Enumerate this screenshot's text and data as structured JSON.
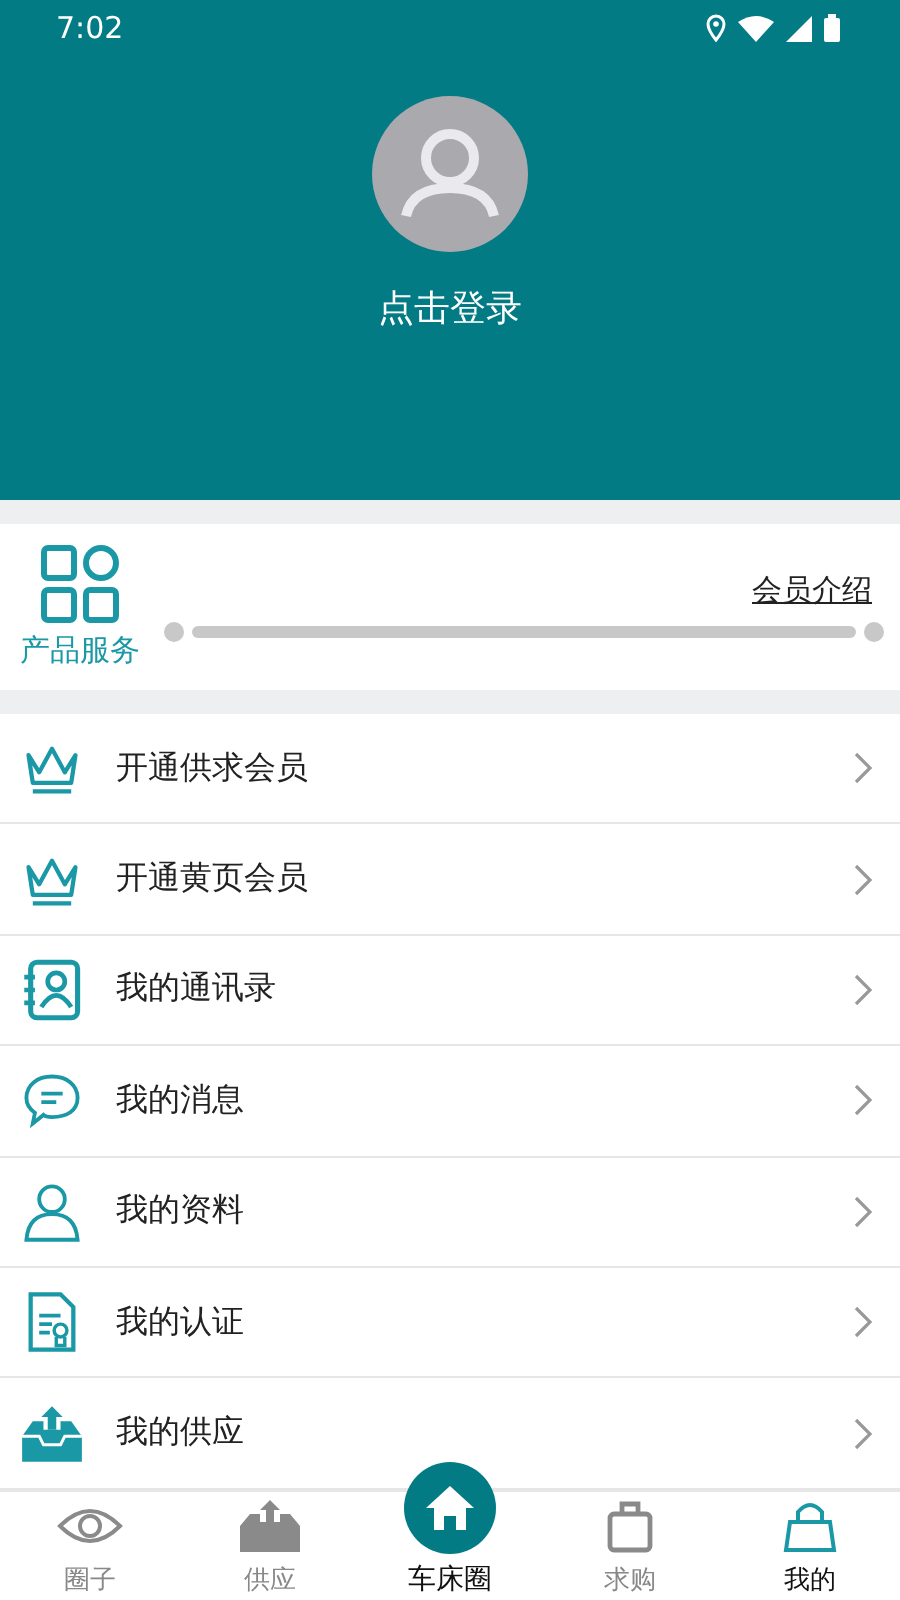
{
  "status_bar": {
    "time": "7:02"
  },
  "profile": {
    "login_label": "点击登录"
  },
  "services": {
    "label": "产品服务",
    "link": "会员介绍"
  },
  "menu": [
    {
      "kind": "crown",
      "label": "开通供求会员"
    },
    {
      "kind": "crown",
      "label": "开通黄页会员"
    },
    {
      "kind": "contacts",
      "label": "我的通讯录"
    },
    {
      "kind": "message",
      "label": "我的消息"
    },
    {
      "kind": "person",
      "label": "我的资料"
    },
    {
      "kind": "certificate",
      "label": "我的认证"
    },
    {
      "kind": "upload",
      "label": "我的供应"
    }
  ],
  "tab_bar": [
    {
      "kind": "eye",
      "label": "圈子",
      "selected": false
    },
    {
      "kind": "upload",
      "label": "供应",
      "selected": false
    },
    {
      "kind": "home",
      "label": "车床圈",
      "selected": false
    },
    {
      "kind": "cart",
      "label": "求购",
      "selected": false
    },
    {
      "kind": "bag",
      "label": "我的",
      "selected": true
    }
  ]
}
